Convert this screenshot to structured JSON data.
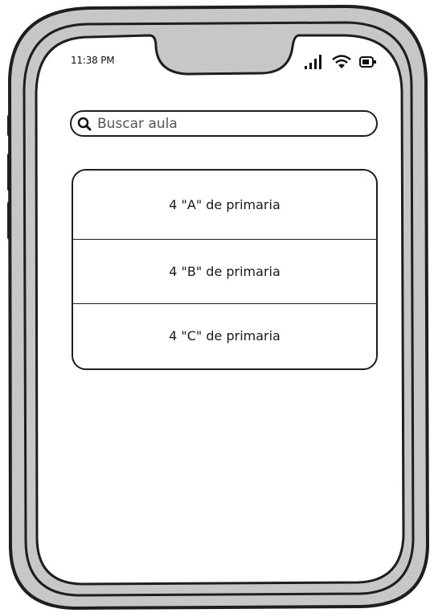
{
  "status_bar": {
    "time": "11:38 PM",
    "icons": [
      "signal-icon",
      "wifi-icon",
      "battery-icon"
    ]
  },
  "search": {
    "placeholder": "Buscar aula",
    "value": "",
    "icon": "search-icon"
  },
  "classrooms": [
    {
      "label": "4 \"A\" de primaria"
    },
    {
      "label": "4 \"B\" de primaria"
    },
    {
      "label": "4 \"C\" de primaria"
    }
  ],
  "colors": {
    "frame": "#c7c7c7",
    "outline": "#1e1e1e",
    "screen": "#ffffff"
  }
}
